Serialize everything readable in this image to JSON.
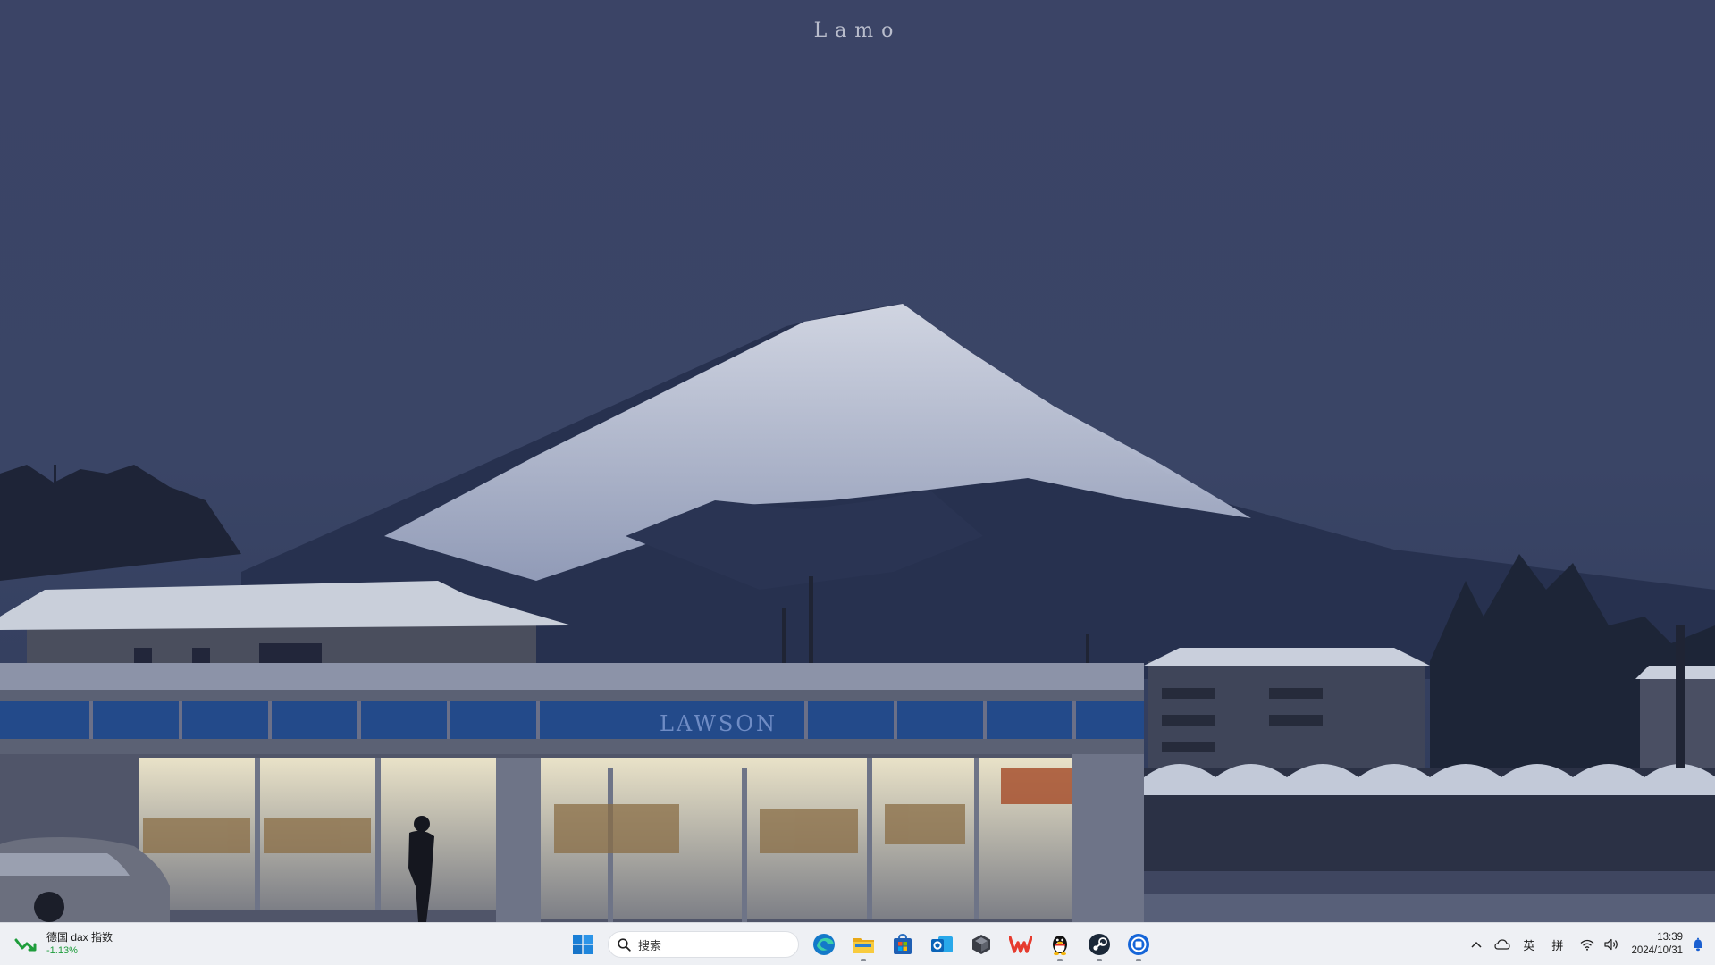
{
  "desktop": {
    "overlay_title": "Lamo",
    "wallpaper_sign": "LAWSON"
  },
  "taskbar": {
    "widget": {
      "title": "德国 dax 指数",
      "value": "-1.13%",
      "trend_color": "#1f9d3c"
    },
    "search": {
      "label": "搜索"
    },
    "apps": [
      {
        "name": "start",
        "running": false
      },
      {
        "name": "edge",
        "running": false
      },
      {
        "name": "file-explorer",
        "running": true
      },
      {
        "name": "microsoft-store",
        "running": false
      },
      {
        "name": "outlook",
        "running": false
      },
      {
        "name": "unity-hub",
        "running": false
      },
      {
        "name": "wps-office",
        "running": false
      },
      {
        "name": "qq",
        "running": true
      },
      {
        "name": "steam",
        "running": true
      },
      {
        "name": "app-blue",
        "running": true
      }
    ],
    "tray": {
      "ime_language": "英",
      "ime_mode": "拼",
      "time": "13:39",
      "date": "2024/10/31"
    }
  }
}
